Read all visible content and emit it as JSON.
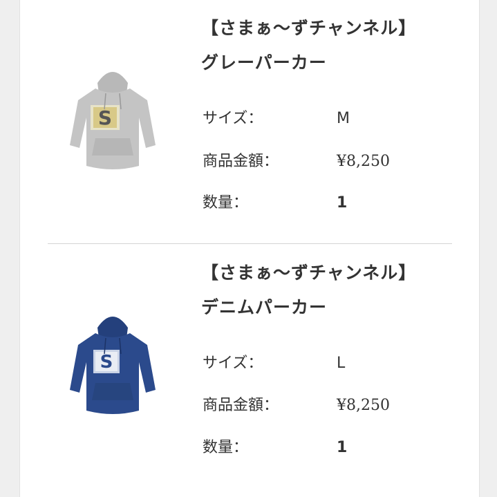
{
  "items": [
    {
      "title_line1": "【さまぁ～ずチャンネル】",
      "title_line2": "グレーパーカー",
      "size_label": "サイズ：",
      "size_value": "M",
      "price_label": "商品金額：",
      "price_value": "¥8,250",
      "qty_label": "数量：",
      "qty_value": "1",
      "hoodie_color": "#bdbdbd",
      "logo_letter": "S"
    },
    {
      "title_line1": "【さまぁ～ずチャンネル】",
      "title_line2": "デニムパーカー",
      "size_label": "サイズ：",
      "size_value": "L",
      "price_label": "商品金額：",
      "price_value": "¥8,250",
      "qty_label": "数量：",
      "qty_value": "1",
      "hoodie_color": "#2b4a8c",
      "logo_letter": "S"
    }
  ]
}
